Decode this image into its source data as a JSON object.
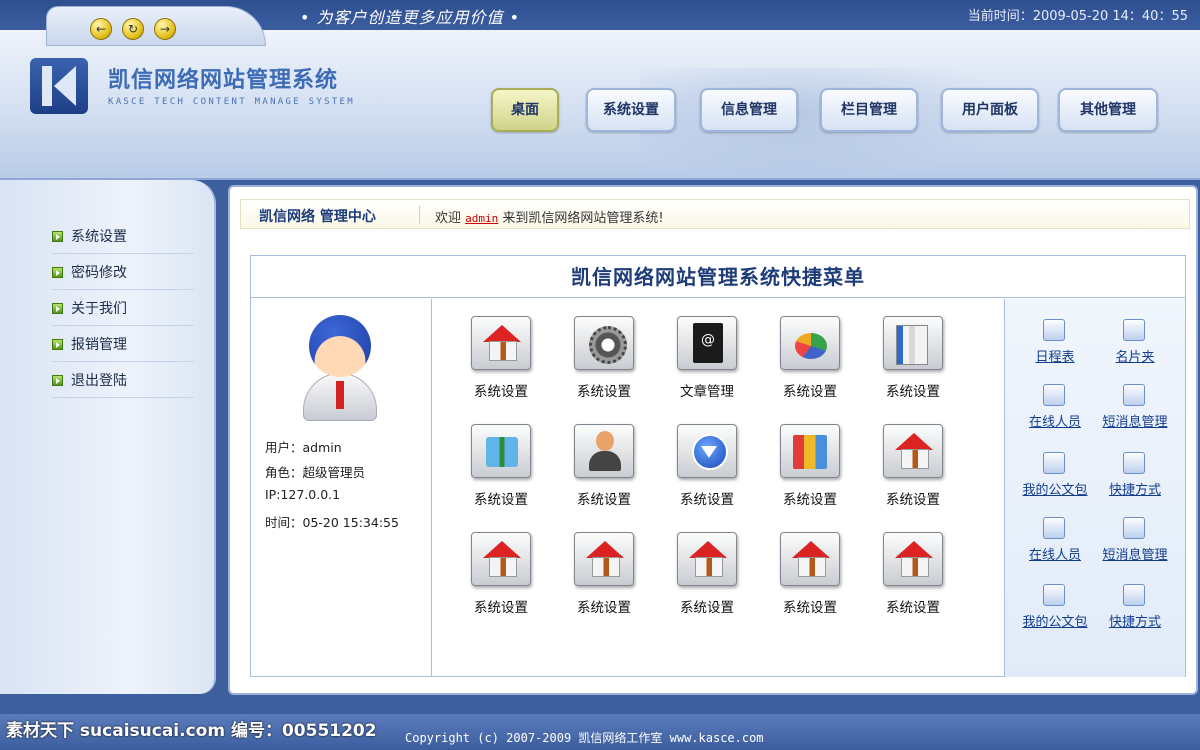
{
  "topbar": {
    "slogan": "• 为客户创造更多应用价值 •",
    "time_label": "当前时间：2009-05-20  14：40：55",
    "nav_buttons": [
      "←",
      "↻",
      "→"
    ]
  },
  "header": {
    "title": "凯信网络网站管理系统",
    "subtitle": "KASCE TECH CONTENT MANAGE SYSTEM",
    "menu": [
      {
        "label": "桌面",
        "active": true
      },
      {
        "label": "系统设置",
        "active": false
      },
      {
        "label": "信息管理",
        "active": false
      },
      {
        "label": "栏目管理",
        "active": false
      },
      {
        "label": "用户面板",
        "active": false
      },
      {
        "label": "其他管理",
        "active": false
      }
    ]
  },
  "sidebar": {
    "items": [
      {
        "label": "系统设置"
      },
      {
        "label": "密码修改"
      },
      {
        "label": "关于我们"
      },
      {
        "label": "报销管理"
      },
      {
        "label": "退出登陆"
      }
    ]
  },
  "welcome": {
    "brand": "凯信网络  管理中心",
    "prefix": "欢迎",
    "user": "admin",
    "suffix": "来到凯信网络网站管理系统!"
  },
  "quick_menu": {
    "title": "凯信网络网站管理系统快捷菜单",
    "user_info": [
      "用户：admin",
      "角色：超级管理员",
      "IP:127.0.0.1",
      "时间：05-20 15:34:55"
    ],
    "tiles": [
      {
        "label": "系统设置",
        "icon": "house-icon"
      },
      {
        "label": "系统设置",
        "icon": "gear-icon"
      },
      {
        "label": "文章管理",
        "icon": "address-book-icon"
      },
      {
        "label": "系统设置",
        "icon": "pie-chart-icon"
      },
      {
        "label": "系统设置",
        "icon": "documents-icon"
      },
      {
        "label": "系统设置",
        "icon": "gift-icon"
      },
      {
        "label": "系统设置",
        "icon": "person-icon"
      },
      {
        "label": "系统设置",
        "icon": "download-icon"
      },
      {
        "label": "系统设置",
        "icon": "books-icon"
      },
      {
        "label": "系统设置",
        "icon": "house-icon"
      },
      {
        "label": "系统设置",
        "icon": "house-icon"
      },
      {
        "label": "系统设置",
        "icon": "house-icon"
      },
      {
        "label": "系统设置",
        "icon": "house-icon"
      },
      {
        "label": "系统设置",
        "icon": "house-icon"
      },
      {
        "label": "系统设置",
        "icon": "house-icon"
      }
    ],
    "links": [
      {
        "label": "日程表",
        "icon": "calendar-icon"
      },
      {
        "label": "名片夹",
        "icon": "card-icon"
      },
      {
        "label": "在线人员",
        "icon": "online-users-icon"
      },
      {
        "label": "短消息管理",
        "icon": "messages-icon"
      },
      {
        "label": "我的公文包",
        "icon": "briefcase-icon"
      },
      {
        "label": "快捷方式",
        "icon": "shortcut-icon"
      },
      {
        "label": "在线人员",
        "icon": "online-users-icon"
      },
      {
        "label": "短消息管理",
        "icon": "messages-icon"
      },
      {
        "label": "我的公文包",
        "icon": "briefcase-icon"
      },
      {
        "label": "快捷方式",
        "icon": "shortcut-icon"
      }
    ]
  },
  "footer": {
    "watermark": "素材天下 sucaisucai.com   编号：00551202",
    "copyright": "Copyright (c) 2007-2009 凯信网络工作室 www.kasce.com"
  },
  "colors": {
    "accent": "#3d5f9e",
    "active_menu": "#cfd48a",
    "link": "#123d8f",
    "user_highlight": "#cc0000"
  }
}
